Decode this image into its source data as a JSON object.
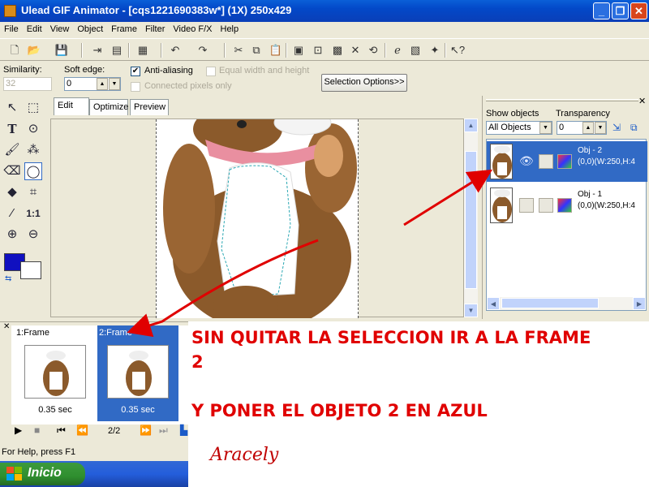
{
  "window": {
    "title": "Ulead GIF Animator - [cqs1221690383w*] (1X) 250x429",
    "controls": [
      "_",
      "❐",
      "✕"
    ]
  },
  "menu": [
    "File",
    "Edit",
    "View",
    "Object",
    "Frame",
    "Filter",
    "Video F/X",
    "Help"
  ],
  "options": {
    "similarity_label": "Similarity:",
    "similarity_value": "32",
    "soft_edge_label": "Soft edge:",
    "soft_edge_value": "0",
    "anti_aliasing_label": "Anti-aliasing",
    "anti_aliasing_checked": true,
    "equal_wh_label": "Equal width and height",
    "connected_label": "Connected pixels only",
    "selection_options_btn": "Selection Options>>"
  },
  "tools": {
    "zoom_ratio_label": "1:1"
  },
  "edit_tabs": [
    "Edit",
    "Optimize",
    "Preview"
  ],
  "objects_panel": {
    "show_objects_label": "Show objects",
    "show_objects_value": "All Objects",
    "transparency_label": "Transparency",
    "transparency_value": "0",
    "objects": [
      {
        "name": "Obj - 2",
        "info": "(0,0)(W:250,H:4",
        "selected": true
      },
      {
        "name": "Obj - 1",
        "info": "(0,0)(W:250,H:4",
        "selected": false
      }
    ]
  },
  "frame_panel": {
    "frames": [
      {
        "label": "1:Frame",
        "delay": "0.35 sec",
        "selected": false
      },
      {
        "label": "2:Frame",
        "delay": "0.35 sec",
        "selected": true
      }
    ],
    "frame_counter": "2/2"
  },
  "status_text": "For Help, press F1",
  "taskbar": {
    "start_label": "Inicio"
  },
  "annotation": {
    "line1": "SIN QUITAR LA SELECCION  IR A LA FRAME",
    "line1b": "2",
    "line2": "Y PONER EL OBJETO 2 EN AZUL",
    "signature": "Aracely"
  },
  "colors": {
    "selection_blue": "#316ac5",
    "annotation_red": "#e00000",
    "foreground_color": "#1010c0",
    "background_color": "#ffffff"
  }
}
